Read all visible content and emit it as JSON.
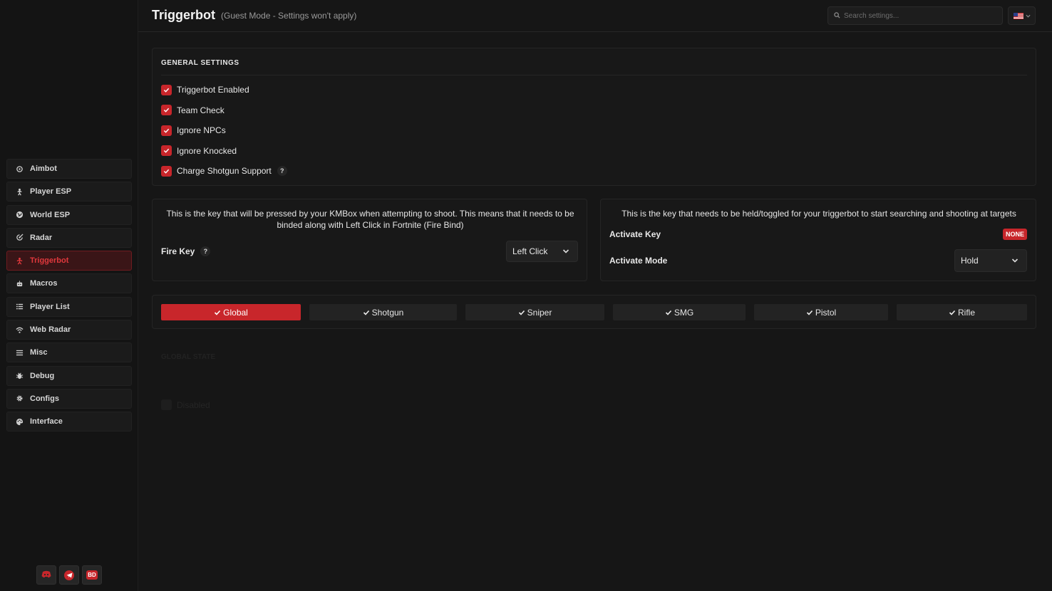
{
  "header": {
    "title": "Triggerbot",
    "subtitle": "(Guest Mode - Settings won't apply)",
    "search_placeholder": "Search settings...",
    "language_icon": "us-flag-icon"
  },
  "sidebar": {
    "items": [
      {
        "label": "Aimbot",
        "icon": "crosshair-icon"
      },
      {
        "label": "Player ESP",
        "icon": "person-icon"
      },
      {
        "label": "World ESP",
        "icon": "globe-icon"
      },
      {
        "label": "Radar",
        "icon": "radar-icon"
      },
      {
        "label": "Triggerbot",
        "icon": "trigger-icon",
        "active": true
      },
      {
        "label": "Macros",
        "icon": "robot-icon"
      },
      {
        "label": "Player List",
        "icon": "list-icon"
      },
      {
        "label": "Web Radar",
        "icon": "wifi-icon"
      },
      {
        "label": "Misc",
        "icon": "menu-icon"
      },
      {
        "label": "Debug",
        "icon": "bug-icon"
      },
      {
        "label": "Configs",
        "icon": "gear-icon"
      },
      {
        "label": "Interface",
        "icon": "palette-icon"
      }
    ],
    "socials": [
      {
        "icon": "discord-icon"
      },
      {
        "icon": "telegram-icon"
      },
      {
        "icon": "bd-icon",
        "text": "BD"
      }
    ]
  },
  "general": {
    "title": "GENERAL SETTINGS",
    "options": [
      {
        "label": "Triggerbot Enabled",
        "checked": true
      },
      {
        "label": "Team Check",
        "checked": true
      },
      {
        "label": "Ignore NPCs",
        "checked": true
      },
      {
        "label": "Ignore Knocked",
        "checked": true
      },
      {
        "label": "Charge Shotgun Support",
        "checked": true,
        "help": "?"
      }
    ]
  },
  "fire": {
    "description": "This is the key that will be pressed by your KMBox when attempting to shoot. This means that it needs to be binded along with Left Click in Fortnite (Fire Bind)",
    "label": "Fire Key",
    "help": "?",
    "value": "Left Click"
  },
  "activate": {
    "description": "This is the key that needs to be held/toggled for your triggerbot to start searching and shooting at targets",
    "key_label": "Activate Key",
    "key_value": "NONE",
    "mode_label": "Activate Mode",
    "mode_value": "Hold"
  },
  "weapon_tabs": [
    {
      "label": "Global",
      "active": true
    },
    {
      "label": "Shotgun"
    },
    {
      "label": "Sniper"
    },
    {
      "label": "SMG"
    },
    {
      "label": "Pistol"
    },
    {
      "label": "Rifle"
    }
  ],
  "faded": {
    "state_title": "GLOBAL STATE",
    "disabled_label": "Disabled"
  },
  "colors": {
    "accent": "#c8262b",
    "background": "#161616",
    "panel": "#181818"
  }
}
